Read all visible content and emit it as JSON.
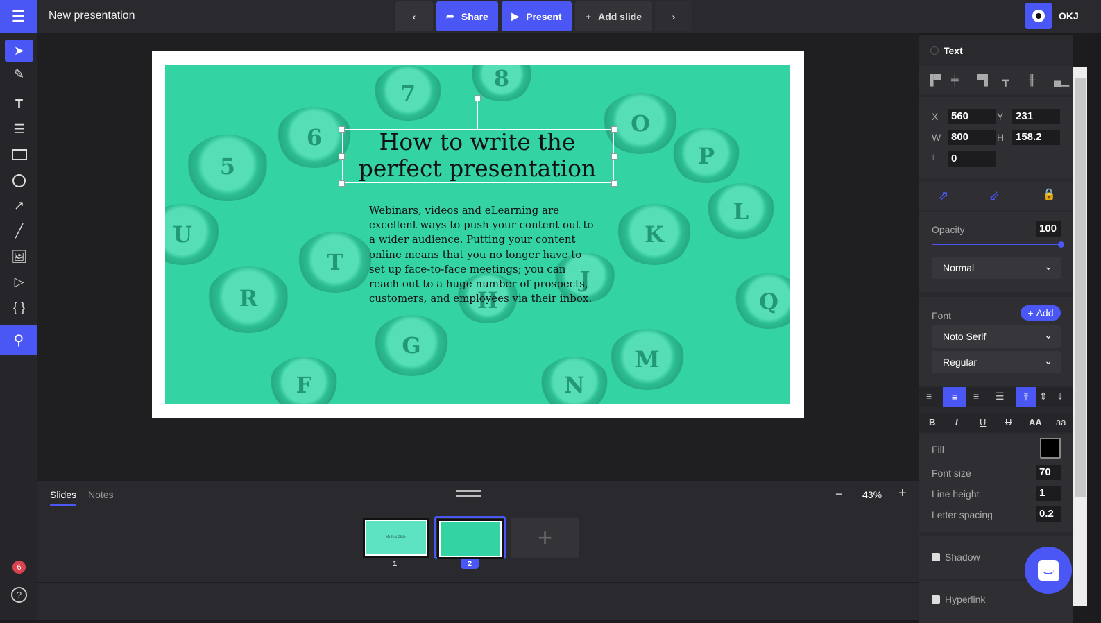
{
  "header": {
    "title": "New presentation",
    "share": "Share",
    "present": "Present",
    "add_slide": "Add slide",
    "user": "OKJ"
  },
  "colors": {
    "accent": "#4b57f5",
    "slide_bg": "#33d3a3"
  },
  "tools": [
    "select-icon",
    "pencil-icon",
    "text-icon",
    "text-list-icon",
    "rectangle-icon",
    "circle-icon",
    "arrow-icon",
    "line-icon",
    "image-icon",
    "video-icon",
    "code-braces-icon",
    "search-icon"
  ],
  "notifications": "6",
  "slide": {
    "title": "How to write the perfect presentation",
    "body": "Webinars, videos and eLearning are excellent ways to push your content out to a wider audience. Putting your content online means that you no longer have to set up face-to-face meetings; you can reach out to a huge number of prospects, customers, and employees via their inbox.",
    "keys": [
      "7",
      "8",
      "6",
      "5",
      "O",
      "P",
      "T",
      "R",
      "K",
      "L",
      "J",
      "G",
      "F",
      "M",
      "N",
      "H",
      "Q",
      "U"
    ]
  },
  "bottom": {
    "tab_slides": "Slides",
    "tab_notes": "Notes",
    "zoom": "43%",
    "zoom_minus": "−",
    "zoom_plus": "+",
    "slides": [
      {
        "number": "1",
        "label": "My first Slide"
      },
      {
        "number": "2"
      }
    ]
  },
  "panel": {
    "section": "Text",
    "x_label": "X",
    "x": "560",
    "y_label": "Y",
    "y": "231",
    "w_label": "W",
    "w": "800",
    "h_label": "H",
    "h": "158.2",
    "rotation": "0",
    "opacity_label": "Opacity",
    "opacity": "100",
    "blend": "Normal",
    "font_label": "Font",
    "add": "Add",
    "font_family": "Noto Serif",
    "font_weight": "Regular",
    "fill_label": "Fill",
    "fill_color": "#000000",
    "font_size_label": "Font size",
    "font_size": "70",
    "line_height_label": "Line height",
    "line_height": "1",
    "letter_spacing_label": "Letter spacing",
    "letter_spacing": "0.2",
    "shadow": "Shadow",
    "hyperlink": "Hyperlink",
    "bold": "B",
    "italic": "I",
    "underline": "U",
    "strike": "U",
    "upper": "AA",
    "lower": "aa"
  }
}
